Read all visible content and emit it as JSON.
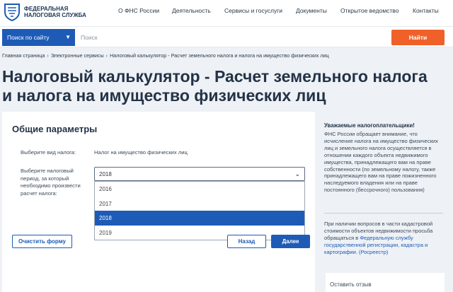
{
  "header": {
    "brand_line1": "ФЕДЕРАЛЬНАЯ",
    "brand_line2": "НАЛОГОВАЯ СЛУЖБА",
    "nav": [
      "О ФНС России",
      "Деятельность",
      "Сервисы и госуслуги",
      "Документы",
      "Открытое ведомство",
      "Контакты"
    ]
  },
  "search": {
    "scope": "Поиск по сайту",
    "placeholder": "Поиск",
    "button": "Найти"
  },
  "breadcrumb": [
    "Главная страница",
    "Электронные сервисы",
    "Налоговый калькулятор - Расчет земельного налога и налога на имущество физических лиц"
  ],
  "page_title": "Налоговый калькулятор - Расчет земельного налога и налога на имущество физических лиц",
  "form": {
    "title": "Общие параметры",
    "tax_type_label": "Выберите вид налога:",
    "tax_type_value": "Налог на имущество физических лиц",
    "period_label": "Выберите налоговый период, за который необходимо произвести расчет налога:",
    "period_selected": "2018",
    "period_options": [
      "2016",
      "2017",
      "2018",
      "2019"
    ],
    "clear_button": "Очистить форму",
    "back_button": "Назад",
    "next_button": "Далее"
  },
  "sidebar": {
    "heading": "Уважаемые налогоплательщики!",
    "text": "ФНС России обращает внимание, что исчисление налога на имущество физических лиц и земельного налога осуществляется в отношении каждого объекта недвижимого имущества, принадлежащего вам на праве собственности (по земельному налогу, также принадлежащего вам на праве пожизненного наследуемого владения или на праве постоянного (бессрочного) пользования)",
    "text2": "При наличии вопросов в части кадастровой стоимости объектов недвижимости просьба обращаться в",
    "link": "Федеральную службу государственной регистрации, кадастра и картографии. (Росреестр)",
    "feedback": "Оставить отзыв"
  },
  "colors": {
    "primary": "#1d5bb6",
    "accent": "#f0612a",
    "background": "#eef1f5"
  }
}
